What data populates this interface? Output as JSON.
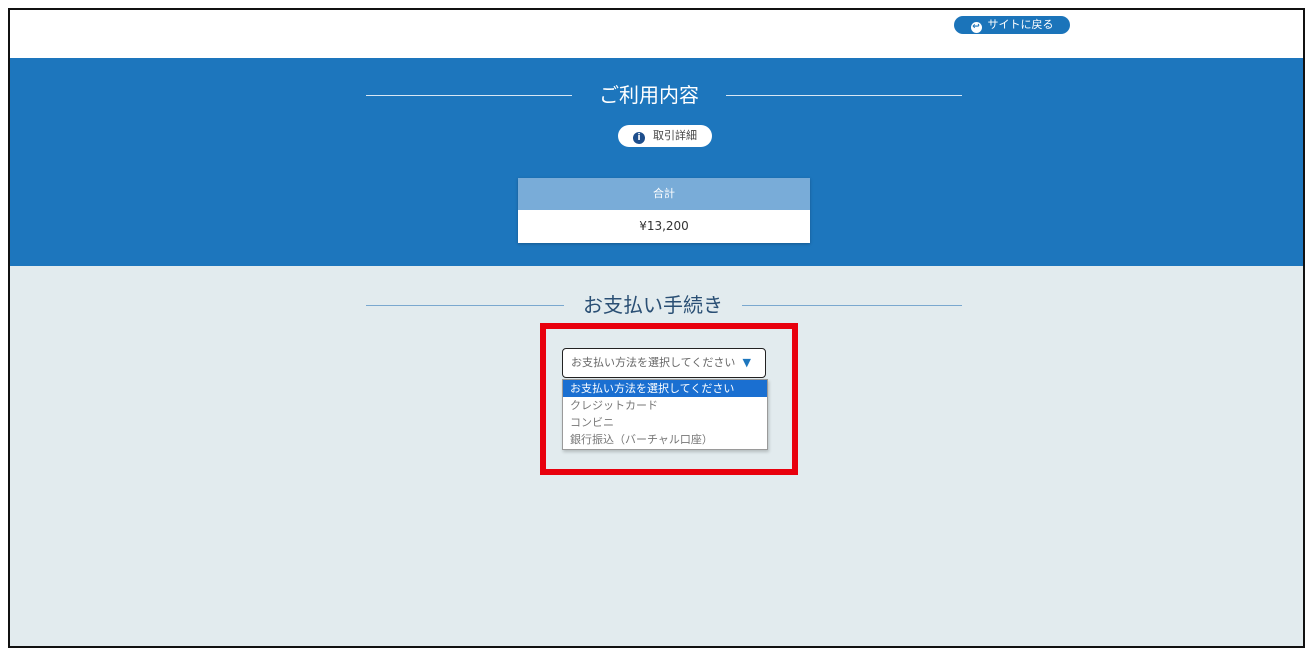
{
  "header": {
    "back_label": "サイトに戻る",
    "back_icon": "return-arrow-icon"
  },
  "usage": {
    "title": "ご利用内容",
    "detail_label": "取引詳細",
    "detail_icon": "info-icon",
    "total_label": "合計",
    "total_value": "¥13,200"
  },
  "payment": {
    "title": "お支払い手続き",
    "select_value": "お支払い方法を選択してください",
    "options": [
      "お支払い方法を選択してください",
      "クレジットカード",
      "コンビニ",
      "銀行振込（バーチャル口座）"
    ],
    "selected_index": 0
  },
  "colors": {
    "accent": "#1d76bd",
    "highlight_border": "#e8000d",
    "section_bg": "#e2ebee",
    "selected_option": "#1a6fd1"
  }
}
